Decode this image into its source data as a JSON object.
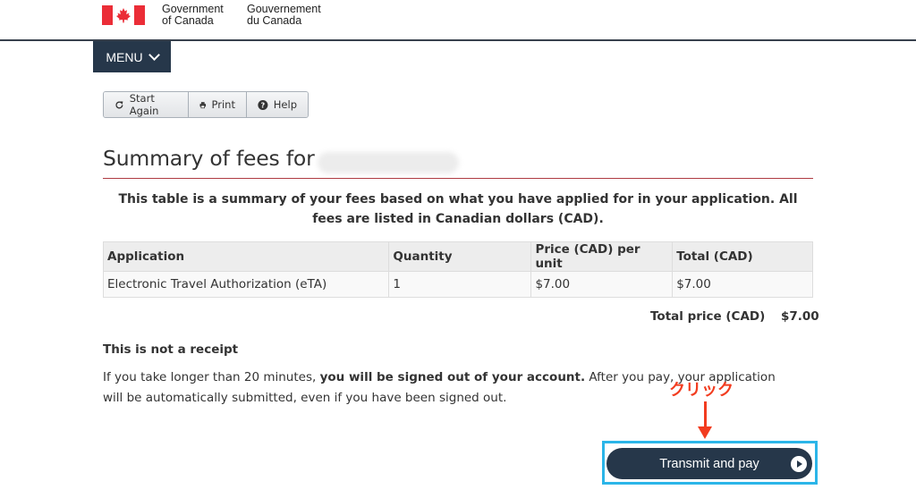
{
  "header": {
    "signature_en_line1": "Government",
    "signature_en_line2": "of Canada",
    "signature_fr_line1": "Gouvernement",
    "signature_fr_line2": "du Canada"
  },
  "menu": {
    "label": "MENU"
  },
  "toolbar": {
    "start_again": "Start Again",
    "print": "Print",
    "help": "Help"
  },
  "page": {
    "title": "Summary of fees for",
    "intro": "This table is a summary of your fees based on what you have applied for in your application. All fees are listed in Canadian dollars (CAD)."
  },
  "fees_table": {
    "headers": [
      "Application",
      "Quantity",
      "Price (CAD) per unit",
      "Total (CAD)"
    ],
    "rows": [
      [
        "Electronic Travel Authorization (eTA)",
        "1",
        "$7.00",
        "$7.00"
      ]
    ]
  },
  "total": {
    "label": "Total price (CAD)",
    "value": "$7.00"
  },
  "receipt": {
    "heading": "This is not a receipt",
    "note_part1": "If you take longer than 20 minutes, ",
    "note_bold": "you will be signed out of your account.",
    "note_part2": " After you pay, your application will be automatically submitted, even if you have been signed out."
  },
  "annotation": {
    "text": "クリック",
    "color": "#f23c1f"
  },
  "pay_button": {
    "label": "Transmit and pay"
  },
  "colors": {
    "brand_dark": "#26374a",
    "rule_red": "#af3c43",
    "flag_red": "#eb2d37",
    "highlight": "#2bb5e8"
  }
}
